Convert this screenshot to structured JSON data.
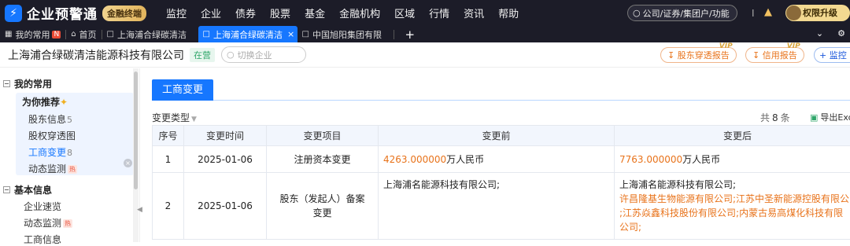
{
  "app": {
    "logo_glyph": "⚡",
    "name": "企业预警通",
    "badge": "金融终端",
    "nav": [
      "监控",
      "企业",
      "债券",
      "股票",
      "基金",
      "金融机构",
      "区域",
      "行情",
      "资讯",
      "帮助"
    ],
    "search_placeholder": "公司/证券/集团户/功能",
    "divider": "I",
    "upgrade_label": "权限升级 ▸",
    "accent": "#1677ff"
  },
  "tabs": {
    "my_favorites": "我的常用",
    "my_favorites_tag": "N",
    "home": "首页",
    "items": [
      {
        "label": "上海浦合绿碳清洁",
        "active": false
      },
      {
        "label": "上海浦合绿碳清洁",
        "active": true
      },
      {
        "label": "中国旭阳集团有限",
        "active": false
      }
    ],
    "close_glyph": "×",
    "plus": "+",
    "right_icons": [
      "chevron-down-icon",
      "settings-icon"
    ]
  },
  "company": {
    "name": "上海浦合绿碳清洁能源科技有限公司",
    "status": "在营",
    "switch_placeholder": "切换企业",
    "btn_penetration": "股东穿透报告",
    "btn_credit": "信用报告",
    "btn_monitor": "监控",
    "vip": "VIP"
  },
  "sidebar": {
    "group1": "我的常用",
    "recommend": "为你推荐",
    "items1": [
      {
        "label": "股东信息",
        "num": "5"
      },
      {
        "label": "股权穿透图",
        "num": ""
      },
      {
        "label": "工商变更",
        "num": "8"
      },
      {
        "label": "动态监测",
        "num": "",
        "hot": "热"
      }
    ],
    "group2": "基本信息",
    "items2": [
      {
        "label": "企业速览"
      },
      {
        "label": "动态监测",
        "hot": "热"
      },
      {
        "label": "工商信息"
      }
    ]
  },
  "main": {
    "tab": "工商变更",
    "filter": "变更类型",
    "count_prefix": "共",
    "count": "8",
    "count_suffix": "条",
    "export": "导出Exc",
    "columns": [
      "序号",
      "变更时间",
      "变更项目",
      "变更前",
      "变更后"
    ],
    "rows": [
      {
        "index": "1",
        "date": "2025-01-06",
        "item": "注册资本变更",
        "before_num": "4263.000000",
        "before_unit": "万人民币",
        "after_num": "7763.000000",
        "after_unit": "万人民币"
      },
      {
        "index": "2",
        "date": "2025-01-06",
        "item": "股东（发起人）备案变更",
        "before": "上海浦名能源科技有限公司;",
        "after_line1": "上海浦名能源科技有限公司;",
        "after_line2": "许昌隆基生物能源有限公司;江苏中圣新能源控股有限公",
        "after_line3": ";江苏焱鑫科技股份有限公司;内蒙古易高煤化科技有限",
        "after_line4": "公司;"
      }
    ]
  }
}
